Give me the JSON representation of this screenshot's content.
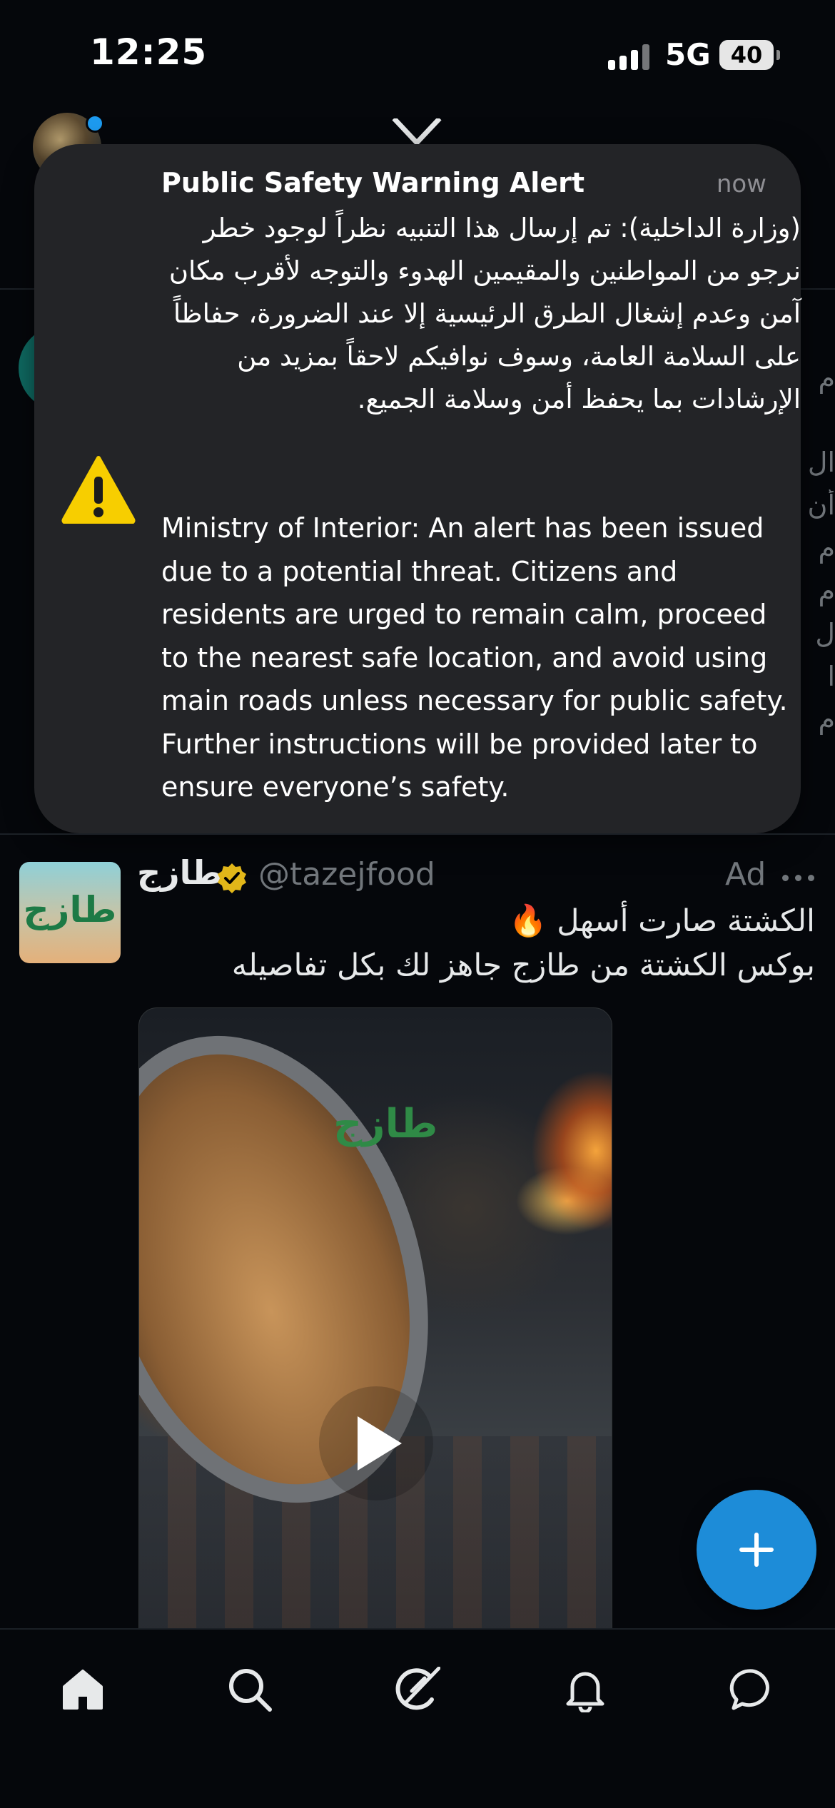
{
  "status_bar": {
    "time": "12:25",
    "network": "5G",
    "battery": "40"
  },
  "alert": {
    "title": "Public Safety Warning Alert",
    "time": "now",
    "body_ar": "(وزارة الداخلية): تم إرسال هذا التنبيه نظراً لوجود خطر نرجو من المواطنين والمقيمين الهدوء والتوجه لأقرب مكان آمن وعدم إشغال الطرق الرئيسية إلا عند الضرورة، حفاظاً على السلامة العامة، وسوف نوافيكم لاحقاً بمزيد من الإرشادات بما يحفظ أمن وسلامة الجميع.",
    "body_en": "Ministry of Interior: An alert has been issued due to a potential threat. Citizens and residents are urged to remain calm, proceed to the nearest safe location, and avoid using main roads unless necessary for public safety. Further instructions will be provided later to ensure everyone’s safety.",
    "icon": "warning-icon"
  },
  "ad_tweet": {
    "name": "طازج",
    "handle": "@tazejfood",
    "ad_label": "Ad",
    "text_line1": "الكشتة صارت أسهل 🔥",
    "text_line2": "بوكس الكشتة من طازج جاهز لك بكل تفاصيله",
    "avatar_text": "طازج",
    "video_watermark": "طازج",
    "verified_color": "#e2b719"
  },
  "nav": {
    "items": [
      "home-icon",
      "search-icon",
      "grok-icon",
      "notifications-icon",
      "messages-icon"
    ]
  },
  "colors": {
    "accent": "#1d9bf0",
    "alert_bg": "#232427",
    "background": "#05070b"
  }
}
